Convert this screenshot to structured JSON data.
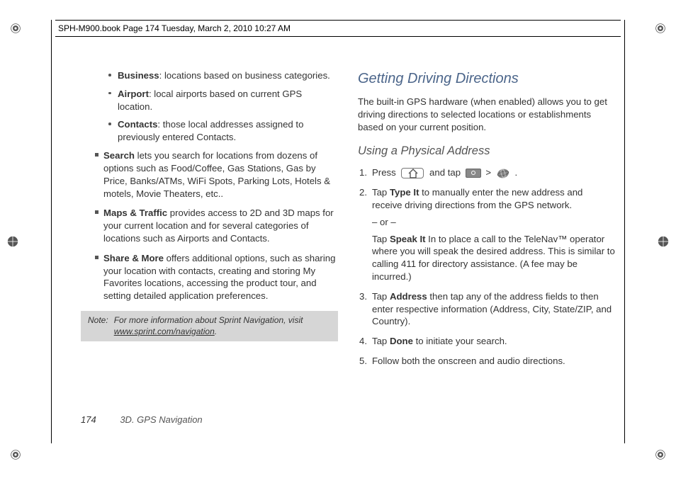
{
  "header": "SPH-M900.book  Page 174  Tuesday, March 2, 2010  10:27 AM",
  "left_col": {
    "dot_items": [
      {
        "term": "Business",
        "desc": ": locations based on business categories."
      },
      {
        "term": "Airport",
        "desc": ": local airports based on current GPS location."
      },
      {
        "term": "Contacts",
        "desc": ": those local addresses assigned to previously entered Contacts."
      }
    ],
    "sq_items": [
      {
        "term": "Search",
        "desc": " lets you search for locations from dozens of options such as Food/Coffee, Gas Stations, Gas by Price, Banks/ATMs, WiFi Spots, Parking Lots, Hotels & motels, Movie Theaters, etc.."
      },
      {
        "term": "Maps & Traffic",
        "desc": " provides access to 2D and 3D maps for your current location and for several categories of locations such as Airports and Contacts."
      },
      {
        "term": "Share & More",
        "desc": " offers additional options, such as sharing your location with contacts, creating and storing My Favorites locations, accessing the product tour, and setting detailed application preferences."
      }
    ],
    "note_label": "Note:",
    "note_text": "For more information about Sprint Navigation, visit ",
    "note_link": "www.sprint.com/navigation"
  },
  "right_col": {
    "heading": "Getting Driving Directions",
    "intro": "The built-in GPS hardware (when enabled) allows you to get driving directions to selected locations or establishments based on your current position.",
    "subheading": "Using a Physical Address",
    "step1_a": "Press ",
    "step1_b": " and tap ",
    "step1_gt": " > ",
    "step1_c": " .",
    "step2_a": "Tap ",
    "step2_term1": "Type It",
    "step2_b": " to manually enter the new address and receive driving directions from the GPS network.",
    "step2_or": "– or –",
    "step2_c": "Tap ",
    "step2_term2": "Speak It",
    "step2_d": " In to place a call to the TeleNav™ operator where you will speak the desired address. This is similar to calling 411 for directory assistance. (A fee may be incurred.)",
    "step3_a": "Tap ",
    "step3_term": "Address",
    "step3_b": " then tap any of the address fields to then enter respective information (Address, City, State/ZIP, and Country).",
    "step4_a": "Tap ",
    "step4_term": "Done",
    "step4_b": " to initiate your search.",
    "step5": "Follow both the onscreen and audio directions."
  },
  "footer": {
    "page": "174",
    "section": "3D. GPS Navigation"
  }
}
